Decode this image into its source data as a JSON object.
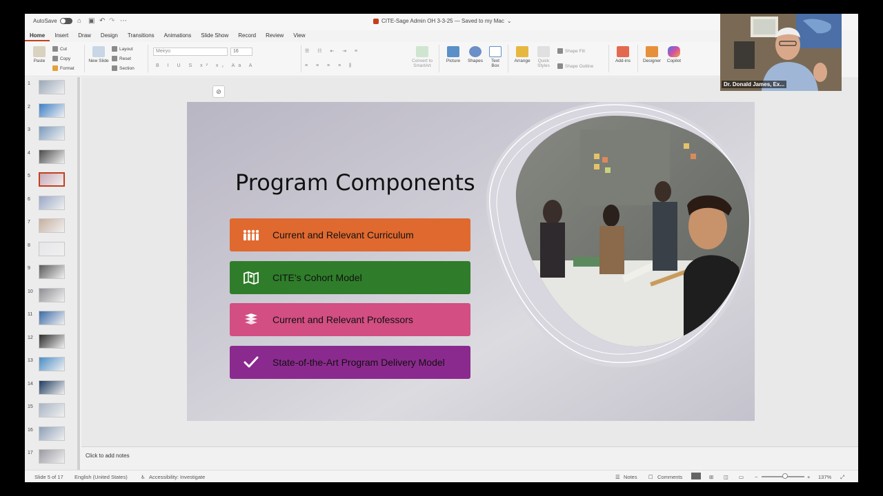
{
  "titlebar": {
    "autosave_label": "AutoSave",
    "doc_title": "CITE-Sage Admin OH 3-3-25 — Saved to my Mac"
  },
  "tabs": [
    "Home",
    "Insert",
    "Draw",
    "Design",
    "Transitions",
    "Animations",
    "Slide Show",
    "Record",
    "Review",
    "View"
  ],
  "ribbon": {
    "paste": "Paste",
    "cut": "Cut",
    "copy": "Copy",
    "format": "Format",
    "new_slide": "New Slide",
    "layout": "Layout",
    "reset": "Reset",
    "section": "Section",
    "font_name": "Meiryo",
    "font_size": "16",
    "convert_smartart": "Convert to SmartArt",
    "picture": "Picture",
    "shapes": "Shapes",
    "text_box": "Text Box",
    "arrange": "Arrange",
    "quick_styles": "Quick Styles",
    "shape_fill": "Shape Fill",
    "shape_outline": "Shape Outline",
    "add_ins": "Add-ins",
    "designer": "Designer",
    "copilot": "Copilot"
  },
  "thumbnails": {
    "numbers": [
      "1",
      "2",
      "3",
      "4",
      "5",
      "6",
      "7",
      "8",
      "9",
      "10",
      "11",
      "12",
      "13",
      "14",
      "15",
      "16",
      "17"
    ],
    "selected_index": 5
  },
  "slide": {
    "title": "Program Components",
    "items": [
      {
        "label": "Current and Relevant Curriculum",
        "color": "#e0692f",
        "icon": "people-icon"
      },
      {
        "label": "CITE’s Cohort Model",
        "color": "#2f7d2a",
        "icon": "map-icon"
      },
      {
        "label": "Current and Relevant Professors",
        "color": "#d24e83",
        "icon": "books-icon"
      },
      {
        "label": "State-of-the-Art Program Delivery Model",
        "color": "#8b2a8e",
        "icon": "checkmark-icon"
      }
    ]
  },
  "notes": {
    "placeholder": "Click to add notes"
  },
  "status": {
    "slide_count": "Slide 5 of 17",
    "language": "English (United States)",
    "accessibility": "Accessibility: Investigate",
    "notes": "Notes",
    "comments": "Comments",
    "zoom": "137%"
  },
  "video": {
    "participant_name": "Dr. Donald James, Ex..."
  }
}
